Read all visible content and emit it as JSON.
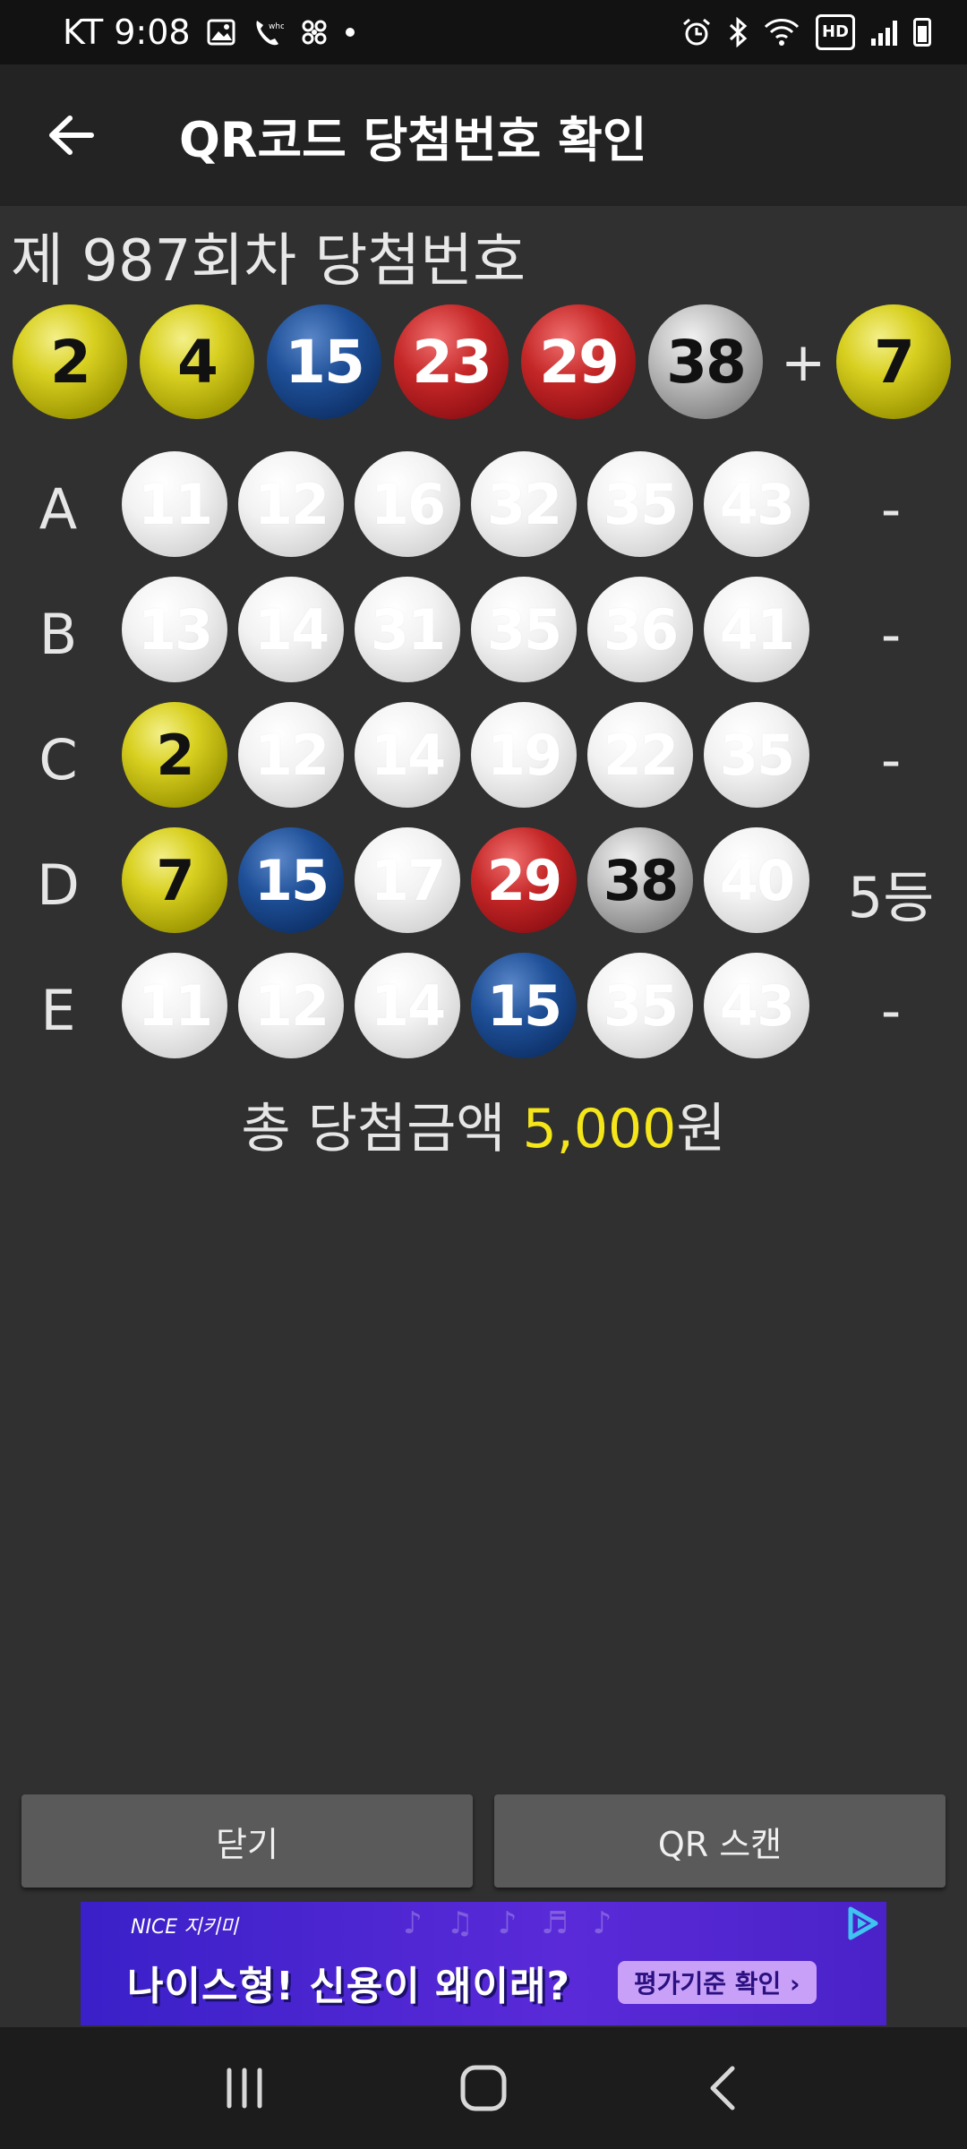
{
  "status_bar": {
    "carrier_time": "KT 9:08",
    "hd": "HD",
    "icons_left": [
      "image-icon",
      "wifi-call-icon",
      "fan-icon",
      "dot-icon"
    ],
    "icons_right": [
      "alarm-icon",
      "bluetooth-icon",
      "wifi-icon",
      "hd-icon",
      "signal-icon",
      "battery-icon"
    ]
  },
  "app_bar": {
    "title": "QR코드 당첨번호 확인",
    "back_icon": "arrow-left-icon"
  },
  "draw": {
    "title": "제 987회차 당첨번호",
    "numbers": [
      {
        "n": "2",
        "color": "yellow"
      },
      {
        "n": "4",
        "color": "yellow"
      },
      {
        "n": "15",
        "color": "blue"
      },
      {
        "n": "23",
        "color": "red"
      },
      {
        "n": "29",
        "color": "red"
      },
      {
        "n": "38",
        "color": "gray"
      }
    ],
    "plus": "+",
    "bonus": {
      "n": "7",
      "color": "yellow"
    }
  },
  "tickets": [
    {
      "label": "A",
      "result": "-",
      "numbers": [
        {
          "n": "11",
          "color": "white"
        },
        {
          "n": "12",
          "color": "white"
        },
        {
          "n": "16",
          "color": "white"
        },
        {
          "n": "32",
          "color": "white"
        },
        {
          "n": "35",
          "color": "white"
        },
        {
          "n": "43",
          "color": "white"
        }
      ]
    },
    {
      "label": "B",
      "result": "-",
      "numbers": [
        {
          "n": "13",
          "color": "white"
        },
        {
          "n": "14",
          "color": "white"
        },
        {
          "n": "31",
          "color": "white"
        },
        {
          "n": "35",
          "color": "white"
        },
        {
          "n": "36",
          "color": "white"
        },
        {
          "n": "41",
          "color": "white"
        }
      ]
    },
    {
      "label": "C",
      "result": "-",
      "numbers": [
        {
          "n": "2",
          "color": "yellow"
        },
        {
          "n": "12",
          "color": "white"
        },
        {
          "n": "14",
          "color": "white"
        },
        {
          "n": "19",
          "color": "white"
        },
        {
          "n": "22",
          "color": "white"
        },
        {
          "n": "35",
          "color": "white"
        }
      ]
    },
    {
      "label": "D",
      "result": "5등",
      "numbers": [
        {
          "n": "7",
          "color": "yellow"
        },
        {
          "n": "15",
          "color": "blue"
        },
        {
          "n": "17",
          "color": "white"
        },
        {
          "n": "29",
          "color": "red"
        },
        {
          "n": "38",
          "color": "gray"
        },
        {
          "n": "40",
          "color": "white"
        }
      ]
    },
    {
      "label": "E",
      "result": "-",
      "numbers": [
        {
          "n": "11",
          "color": "white"
        },
        {
          "n": "12",
          "color": "white"
        },
        {
          "n": "14",
          "color": "white"
        },
        {
          "n": "15",
          "color": "blue"
        },
        {
          "n": "35",
          "color": "white"
        },
        {
          "n": "43",
          "color": "white"
        }
      ]
    }
  ],
  "total": {
    "prefix": "총 당첨금액 ",
    "amount": "5,000",
    "suffix": "원"
  },
  "buttons": {
    "close_label": "닫기",
    "scan_label": "QR 스캔"
  },
  "ad": {
    "brand": "NICE 지키미",
    "headline": "나이스형! 신용이 왜이래?",
    "cta": "평가기준 확인 ›",
    "badge_icon": "ad-choices-icon"
  },
  "nav_bar": {
    "icons": [
      "recent-apps-icon",
      "home-icon",
      "back-icon"
    ]
  }
}
